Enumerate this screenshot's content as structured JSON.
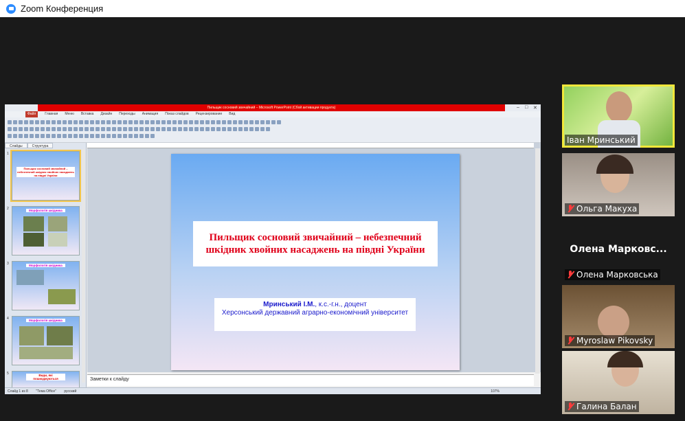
{
  "window": {
    "title": "Zoom Конференция"
  },
  "powerpoint": {
    "title_bar": "Пильщик сосновий звичайний – Microsoft PowerPoint (Сбой активации продукта)",
    "menu": [
      "Файл",
      "Главная",
      "Меню",
      "Вставка",
      "Дизайн",
      "Переходы",
      "Анимация",
      "Показ слайдов",
      "Рецензирование",
      "Вид"
    ],
    "panel_tabs": [
      "Слайды",
      "Структура"
    ],
    "thumbnails": [
      {
        "num": "1",
        "caption": "Пильщик сосновий звичайний – небезпечний шкідник хвойних насаджень на півдні України"
      },
      {
        "num": "2",
        "caption": "Морфологія шкідника"
      },
      {
        "num": "3",
        "caption": "Морфологія шкідника"
      },
      {
        "num": "4",
        "caption": "Морфологія шкідника"
      },
      {
        "num": "5",
        "caption": "Види, які пошкоджуються"
      }
    ],
    "slide": {
      "title_line1": "Пильщик сосновий звичайний – небезпечний",
      "title_line2": "шкідник хвойних насаджень на півдні України",
      "author_name": "Мринський І.М.",
      "author_degree": ", к.с.-г.н., доцент",
      "institution": "Херсонський державний аграрно-економічний університет"
    },
    "notes_placeholder": "Заметки к слайду",
    "status": {
      "slide": "Слайд 1 из 8",
      "theme": "\"Тема Office\"",
      "language": "русский",
      "zoom": "107%"
    }
  },
  "participants": [
    {
      "name": "Іван Мринський",
      "muted": false,
      "active": true,
      "video": true
    },
    {
      "name": "Ольга Макуха",
      "muted": true,
      "active": false,
      "video": true
    },
    {
      "name": "Олена Марковська",
      "display_name": "Олена  Марковс...",
      "muted": true,
      "active": false,
      "video": false
    },
    {
      "name": "Myroslaw Pikovsky",
      "muted": true,
      "active": false,
      "video": true
    },
    {
      "name": "Галина Балан",
      "muted": true,
      "active": false,
      "video": true
    }
  ],
  "colors": {
    "slide_title": "#e0001a",
    "author_text": "#1a1acc",
    "active_speaker": "#f1e73a",
    "zoom_blue": "#2d8cff"
  }
}
